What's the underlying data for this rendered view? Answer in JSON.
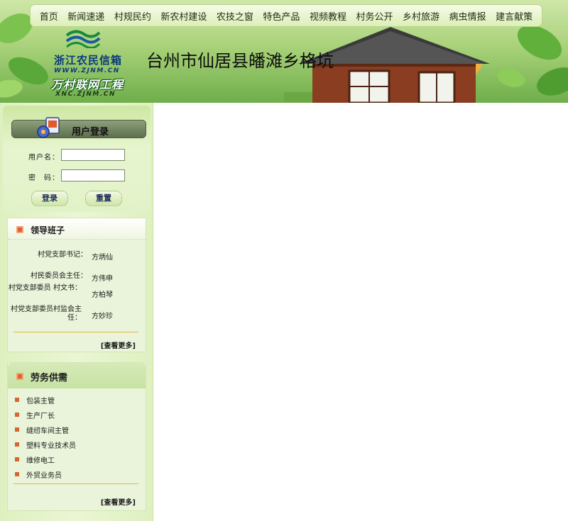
{
  "nav": {
    "items": [
      {
        "label": "首页"
      },
      {
        "label": "新闻速递"
      },
      {
        "label": "村规民约"
      },
      {
        "label": "新农村建设"
      },
      {
        "label": "农技之窗"
      },
      {
        "label": "特色产品"
      },
      {
        "label": "视频教程"
      },
      {
        "label": "村务公开"
      },
      {
        "label": "乡村旅游"
      },
      {
        "label": "病虫情报"
      },
      {
        "label": "建言献策"
      }
    ]
  },
  "logo": {
    "line1": "浙江农民信箱",
    "url1": "WWW.ZJNM.CN",
    "line2": "万村联网工程",
    "url2": "XNC.ZJNM.CN"
  },
  "site_title": "台州市仙居县皤滩乡格坑",
  "login": {
    "title": "用户登录",
    "username_label": "用户名：",
    "password_label": "密　码：",
    "username_value": "",
    "password_value": "",
    "login_button": "登录",
    "reset_button": "重置"
  },
  "leaders": {
    "title": "领导班子",
    "rows": [
      {
        "role": "村党支部书记：",
        "name": "方炳仙"
      },
      {
        "role": "村民委员会主任：",
        "name": "方伟申"
      },
      {
        "role": "村党支部委员 村文书：",
        "name": "方柏琴"
      },
      {
        "role": "村党支部委员村监会主任：",
        "name": "方妙珍"
      }
    ],
    "more": "[查看更多]"
  },
  "jobs": {
    "title": "劳务供需",
    "items": [
      {
        "label": "包装主管"
      },
      {
        "label": "生产厂长"
      },
      {
        "label": "缝纫车间主管"
      },
      {
        "label": "塑料专业技术员"
      },
      {
        "label": "维修电工"
      },
      {
        "label": "外贸业务员"
      }
    ],
    "more": "[查看更多]"
  },
  "colors": {
    "nav_bg": "#dcefb7",
    "sidebar_bg": "#eaf6d4",
    "bullet": "#d8642f",
    "rule": "#e5b84a"
  }
}
